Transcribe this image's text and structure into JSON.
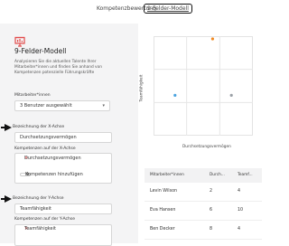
{
  "nav": {
    "tab_competence": "Kompetenzbewertung",
    "tab_ninebox": "9-Felder-Modell"
  },
  "header": {
    "title": "9-Felder-Modell",
    "description_line1": "Analysieren Sie die aktuellen Talente Ihrer",
    "description_line2": "Mitarbeiter*innen und finden Sie anhand von",
    "description_line3": "Kompetenzen potenzielle Führungskräfte"
  },
  "employees": {
    "label": "Mitarbeiter*innen",
    "selected": "3 Benutzer ausgewählt"
  },
  "x_axis_config": {
    "label": "Bezeichnung der X-Achse",
    "value": "Durchsetzungsvermögen",
    "competences_label": "Kompetenzen auf der X-Achse",
    "tags": [
      "Durchsetzungsvermögen"
    ],
    "add_button": "Kompetenzen hinzufügen"
  },
  "y_axis_config": {
    "label": "Bezeichnung der Y-Achse",
    "value": "Teamfähigkeit",
    "competences_label": "Kompetenzen auf der Y-Achse",
    "tags": [
      "Teamfähigkeit"
    ]
  },
  "chart_data": {
    "type": "scatter",
    "title": "",
    "xlabel": "Durchsetzungsvermögen",
    "ylabel": "Teamfähigkeit",
    "xlim": [
      0,
      10
    ],
    "ylim": [
      0,
      10
    ],
    "grid": "3x3",
    "points": [
      {
        "name": "Levin Wilson",
        "x": 2,
        "y": 4,
        "color": "#4aa3df"
      },
      {
        "name": "Eva Hansen",
        "x": 6,
        "y": 10,
        "color": "#f08a24"
      },
      {
        "name": "Ben Decker",
        "x": 8,
        "y": 4,
        "color": "#9aa0a6"
      }
    ]
  },
  "table": {
    "headers": [
      "Mitarbeiter*innen",
      "Durch...",
      "Teamf..."
    ],
    "rows": [
      [
        "Levin Wilson",
        "2",
        "4"
      ],
      [
        "Eva Hansen",
        "6",
        "10"
      ],
      [
        "Ben Decker",
        "8",
        "4"
      ]
    ]
  },
  "colors": {
    "brand_icon": "#e24a4a",
    "remove_x": "#e24a4a",
    "panel_bg": "#f4f4f5"
  }
}
